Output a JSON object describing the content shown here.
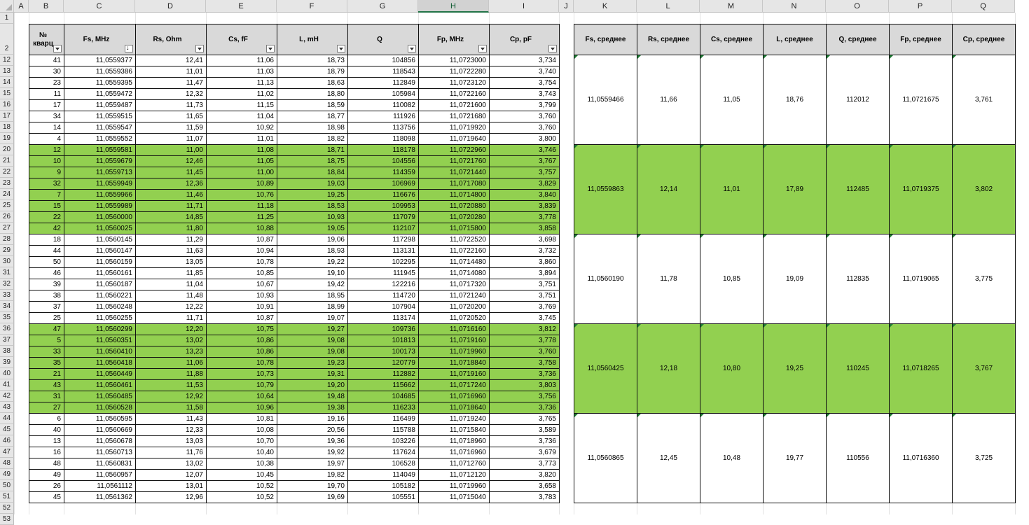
{
  "column_letters": [
    "A",
    "B",
    "C",
    "D",
    "E",
    "F",
    "G",
    "H",
    "I",
    "J",
    "K",
    "L",
    "M",
    "N",
    "O",
    "P",
    "Q"
  ],
  "selected_column": "H",
  "header_row_numbers": [
    "1",
    "2"
  ],
  "headers": [
    "№ кварц",
    "Fs, MHz",
    "Rs, Ohm",
    "Cs, fF",
    "L, mH",
    "Q",
    "Fp, MHz",
    "Cp, pF"
  ],
  "summary_headers": [
    "Fs, среднее",
    "Rs, среднее",
    "Cs, среднее",
    "L, среднее",
    "Q, среднее",
    "Fp, среднее",
    "Cp, среднее"
  ],
  "rows": [
    {
      "n": "12",
      "g": false,
      "v": [
        "41",
        "11,0559377",
        "12,41",
        "11,06",
        "18,73",
        "104856",
        "11,0723000",
        "3,734"
      ]
    },
    {
      "n": "13",
      "g": false,
      "v": [
        "30",
        "11,0559386",
        "11,01",
        "11,03",
        "18,79",
        "118543",
        "11,0722280",
        "3,740"
      ]
    },
    {
      "n": "14",
      "g": false,
      "v": [
        "23",
        "11,0559395",
        "11,47",
        "11,13",
        "18,63",
        "112849",
        "11,0723120",
        "3,754"
      ]
    },
    {
      "n": "15",
      "g": false,
      "v": [
        "11",
        "11,0559472",
        "12,32",
        "11,02",
        "18,80",
        "105984",
        "11,0722160",
        "3,743"
      ]
    },
    {
      "n": "16",
      "g": false,
      "v": [
        "17",
        "11,0559487",
        "11,73",
        "11,15",
        "18,59",
        "110082",
        "11,0721600",
        "3,799"
      ]
    },
    {
      "n": "17",
      "g": false,
      "v": [
        "34",
        "11,0559515",
        "11,65",
        "11,04",
        "18,77",
        "111926",
        "11,0721680",
        "3,760"
      ]
    },
    {
      "n": "18",
      "g": false,
      "v": [
        "14",
        "11,0559547",
        "11,59",
        "10,92",
        "18,98",
        "113756",
        "11,0719920",
        "3,760"
      ]
    },
    {
      "n": "19",
      "g": false,
      "v": [
        "4",
        "11,0559552",
        "11,07",
        "11,01",
        "18,82",
        "118098",
        "11,0719640",
        "3,800"
      ]
    },
    {
      "n": "20",
      "g": true,
      "v": [
        "12",
        "11,0559581",
        "11,00",
        "11,08",
        "18,71",
        "118178",
        "11,0722960",
        "3,746"
      ]
    },
    {
      "n": "21",
      "g": true,
      "v": [
        "10",
        "11,0559679",
        "12,46",
        "11,05",
        "18,75",
        "104556",
        "11,0721760",
        "3,767"
      ]
    },
    {
      "n": "22",
      "g": true,
      "v": [
        "9",
        "11,0559713",
        "11,45",
        "11,00",
        "18,84",
        "114359",
        "11,0721440",
        "3,757"
      ]
    },
    {
      "n": "23",
      "g": true,
      "v": [
        "32",
        "11,0559949",
        "12,36",
        "10,89",
        "19,03",
        "106969",
        "11,0717080",
        "3,829"
      ]
    },
    {
      "n": "24",
      "g": true,
      "v": [
        "7",
        "11,0559966",
        "11,46",
        "10,76",
        "19,25",
        "116676",
        "11,0714800",
        "3,840"
      ]
    },
    {
      "n": "25",
      "g": true,
      "v": [
        "15",
        "11,0559989",
        "11,71",
        "11,18",
        "18,53",
        "109953",
        "11,0720880",
        "3,839"
      ]
    },
    {
      "n": "26",
      "g": true,
      "v": [
        "22",
        "11,0560000",
        "14,85",
        "11,25",
        "10,93",
        "117079",
        "11,0720280",
        "3,778"
      ]
    },
    {
      "n": "27",
      "g": true,
      "v": [
        "42",
        "11,0560025",
        "11,80",
        "10,88",
        "19,05",
        "112107",
        "11,0715800",
        "3,858"
      ]
    },
    {
      "n": "28",
      "g": false,
      "v": [
        "18",
        "11,0560145",
        "11,29",
        "10,87",
        "19,06",
        "117298",
        "11,0722520",
        "3,698"
      ]
    },
    {
      "n": "29",
      "g": false,
      "v": [
        "44",
        "11,0560147",
        "11,63",
        "10,94",
        "18,93",
        "113131",
        "11,0722160",
        "3,732"
      ]
    },
    {
      "n": "30",
      "g": false,
      "v": [
        "50",
        "11,0560159",
        "13,05",
        "10,78",
        "19,22",
        "102295",
        "11,0714480",
        "3,860"
      ]
    },
    {
      "n": "31",
      "g": false,
      "v": [
        "46",
        "11,0560161",
        "11,85",
        "10,85",
        "19,10",
        "111945",
        "11,0714080",
        "3,894"
      ]
    },
    {
      "n": "32",
      "g": false,
      "v": [
        "39",
        "11,0560187",
        "11,04",
        "10,67",
        "19,42",
        "122216",
        "11,0717320",
        "3,751"
      ]
    },
    {
      "n": "33",
      "g": false,
      "v": [
        "38",
        "11,0560221",
        "11,48",
        "10,93",
        "18,95",
        "114720",
        "11,0721240",
        "3,751"
      ]
    },
    {
      "n": "34",
      "g": false,
      "v": [
        "37",
        "11,0560248",
        "12,22",
        "10,91",
        "18,99",
        "107904",
        "11,0720200",
        "3,769"
      ]
    },
    {
      "n": "35",
      "g": false,
      "v": [
        "25",
        "11,0560255",
        "11,71",
        "10,87",
        "19,07",
        "113174",
        "11,0720520",
        "3,745"
      ]
    },
    {
      "n": "36",
      "g": true,
      "v": [
        "47",
        "11,0560299",
        "12,20",
        "10,75",
        "19,27",
        "109736",
        "11,0716160",
        "3,812"
      ]
    },
    {
      "n": "37",
      "g": true,
      "v": [
        "5",
        "11,0560351",
        "13,02",
        "10,86",
        "19,08",
        "101813",
        "11,0719160",
        "3,778"
      ]
    },
    {
      "n": "38",
      "g": true,
      "v": [
        "33",
        "11,0560410",
        "13,23",
        "10,86",
        "19,08",
        "100173",
        "11,0719960",
        "3,760"
      ]
    },
    {
      "n": "39",
      "g": true,
      "v": [
        "35",
        "11,0560418",
        "11,06",
        "10,78",
        "19,23",
        "120779",
        "11,0718840",
        "3,758"
      ]
    },
    {
      "n": "40",
      "g": true,
      "v": [
        "21",
        "11,0560449",
        "11,88",
        "10,73",
        "19,31",
        "112882",
        "11,0719160",
        "3,736"
      ]
    },
    {
      "n": "41",
      "g": true,
      "v": [
        "43",
        "11,0560461",
        "11,53",
        "10,79",
        "19,20",
        "115662",
        "11,0717240",
        "3,803"
      ]
    },
    {
      "n": "42",
      "g": true,
      "v": [
        "31",
        "11,0560485",
        "12,92",
        "10,64",
        "19,48",
        "104685",
        "11,0716960",
        "3,756"
      ]
    },
    {
      "n": "43",
      "g": true,
      "v": [
        "27",
        "11,0560528",
        "11,58",
        "10,96",
        "19,38",
        "116233",
        "11,0718640",
        "3,736"
      ]
    },
    {
      "n": "44",
      "g": false,
      "v": [
        "6",
        "11,0560595",
        "11,43",
        "10,81",
        "19,16",
        "116499",
        "11,0719240",
        "3,765"
      ]
    },
    {
      "n": "45",
      "g": false,
      "v": [
        "40",
        "11,0560669",
        "12,33",
        "10,08",
        "20,56",
        "115788",
        "11,0715840",
        "3,589"
      ]
    },
    {
      "n": "46",
      "g": false,
      "v": [
        "13",
        "11,0560678",
        "13,03",
        "10,70",
        "19,36",
        "103226",
        "11,0718960",
        "3,736"
      ]
    },
    {
      "n": "47",
      "g": false,
      "v": [
        "16",
        "11,0560713",
        "11,76",
        "10,40",
        "19,92",
        "117624",
        "11,0716960",
        "3,679"
      ]
    },
    {
      "n": "48",
      "g": false,
      "v": [
        "48",
        "11,0560831",
        "13,02",
        "10,38",
        "19,97",
        "106528",
        "11,0712760",
        "3,773"
      ]
    },
    {
      "n": "49",
      "g": false,
      "v": [
        "49",
        "11,0560957",
        "12,07",
        "10,45",
        "19,82",
        "114049",
        "11,0712120",
        "3,820"
      ]
    },
    {
      "n": "50",
      "g": false,
      "v": [
        "26",
        "11,0561112",
        "13,01",
        "10,52",
        "19,70",
        "105182",
        "11,0719960",
        "3,658"
      ]
    },
    {
      "n": "51",
      "g": false,
      "v": [
        "45",
        "11,0561362",
        "12,96",
        "10,52",
        "19,69",
        "105551",
        "11,0715040",
        "3,783"
      ]
    }
  ],
  "trailing_row_number": "52",
  "trailing_row_number_2": "53",
  "summary_groups": [
    {
      "g": false,
      "v": [
        "11,0559466",
        "11,66",
        "11,05",
        "18,76",
        "112012",
        "11,0721675",
        "3,761"
      ]
    },
    {
      "g": true,
      "v": [
        "11,0559863",
        "12,14",
        "11,01",
        "17,89",
        "112485",
        "11,0719375",
        "3,802"
      ]
    },
    {
      "g": false,
      "v": [
        "11,0560190",
        "11,78",
        "10,85",
        "19,09",
        "112835",
        "11,0719065",
        "3,775"
      ]
    },
    {
      "g": true,
      "v": [
        "11,0560425",
        "12,18",
        "10,80",
        "19,25",
        "110245",
        "11,0718265",
        "3,767"
      ]
    },
    {
      "g": false,
      "v": [
        "11,0560865",
        "12,45",
        "10,48",
        "19,77",
        "110556",
        "11,0716360",
        "3,725"
      ]
    }
  ],
  "colors": {
    "group_fill": "#92d050",
    "header_fill": "#d9d9d9",
    "selected_col": "#217346"
  }
}
